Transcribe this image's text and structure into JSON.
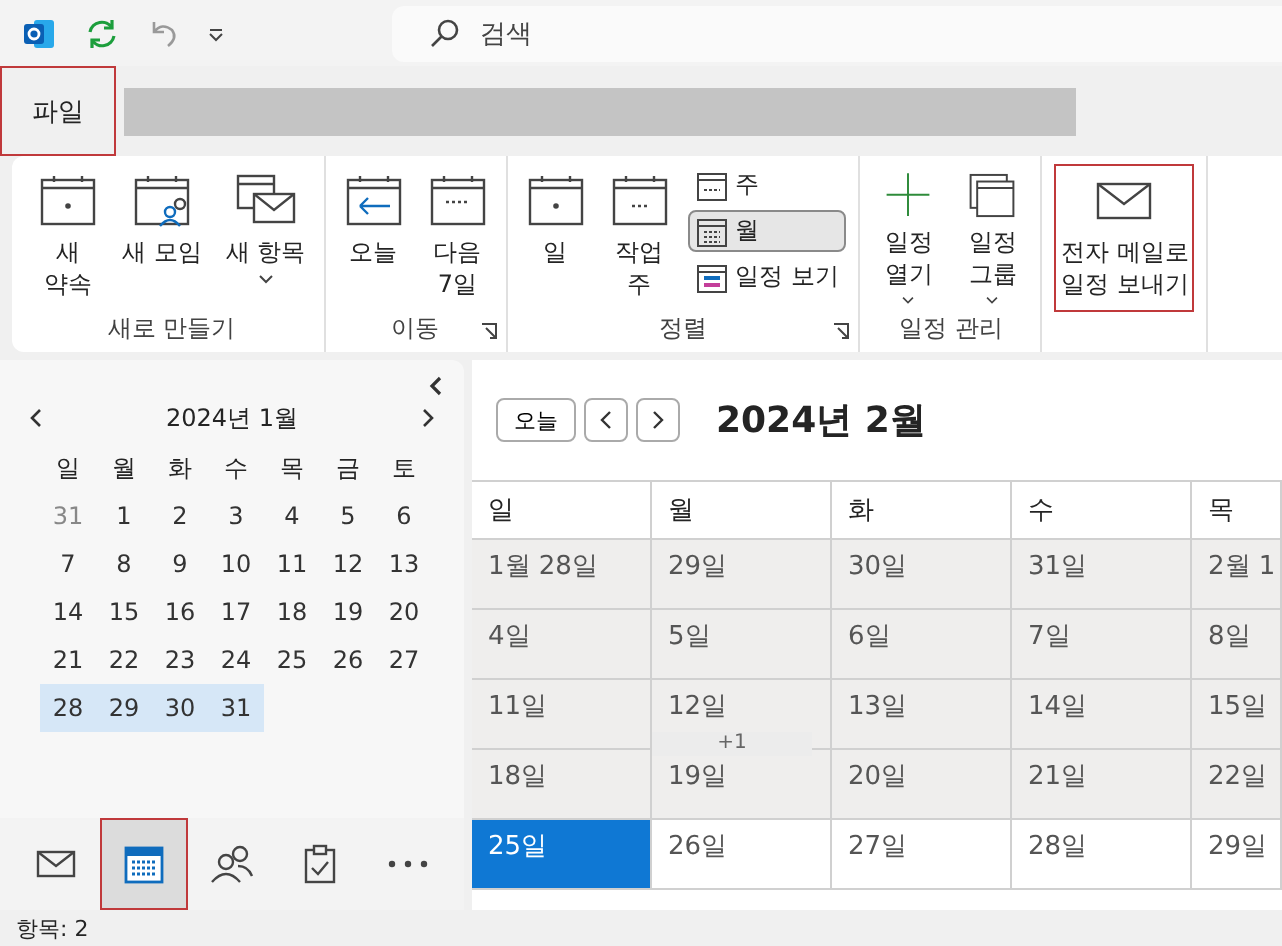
{
  "search": {
    "placeholder": "검색"
  },
  "file_tab": {
    "label": "파일",
    "highlighted": true
  },
  "ribbon": {
    "groups": [
      {
        "label": "새로 만들기",
        "launcher": false,
        "buttons": [
          {
            "kind": "large",
            "label": "새\n약속",
            "dropdown": false,
            "highlighted": false
          },
          {
            "kind": "large",
            "label": "새 모임",
            "dropdown": false,
            "highlighted": false
          },
          {
            "kind": "large",
            "label": "새 항목",
            "dropdown": true,
            "highlighted": false
          }
        ]
      },
      {
        "label": "이동",
        "launcher": true,
        "buttons": [
          {
            "kind": "large",
            "label": "오늘",
            "dropdown": false,
            "highlighted": false
          },
          {
            "kind": "large",
            "label": "다음\n7일",
            "dropdown": false,
            "highlighted": false
          }
        ]
      },
      {
        "label": "정렬",
        "launcher": true,
        "buttons": [
          {
            "kind": "large",
            "label": "일",
            "dropdown": false,
            "highlighted": false
          },
          {
            "kind": "large",
            "label": "작업\n주",
            "dropdown": false,
            "highlighted": false
          },
          {
            "kind": "small",
            "label": "주",
            "selected": false
          },
          {
            "kind": "small",
            "label": "월",
            "selected": true
          },
          {
            "kind": "small",
            "label": "일정 보기",
            "selected": false
          }
        ]
      },
      {
        "label": "일정 관리",
        "launcher": false,
        "buttons": [
          {
            "kind": "large",
            "label": "일정\n열기",
            "dropdown": true,
            "highlighted": false
          },
          {
            "kind": "large",
            "label": "일정\n그룹",
            "dropdown": true,
            "highlighted": false
          }
        ]
      },
      {
        "launcher": false,
        "buttons": [
          {
            "kind": "large",
            "label": "전자 메일로\n일정 보내기",
            "dropdown": false,
            "highlighted": true
          }
        ]
      }
    ]
  },
  "mini_calendar": {
    "title": "2024년 1월",
    "weekdays": [
      "일",
      "월",
      "화",
      "수",
      "목",
      "금",
      "토"
    ],
    "weeks": [
      [
        {
          "day": "31",
          "other_month": true,
          "selected": false
        },
        {
          "day": "1",
          "other_month": false,
          "selected": false
        },
        {
          "day": "2",
          "other_month": false,
          "selected": false
        },
        {
          "day": "3",
          "other_month": false,
          "selected": false
        },
        {
          "day": "4",
          "other_month": false,
          "selected": false
        },
        {
          "day": "5",
          "other_month": false,
          "selected": false
        },
        {
          "day": "6",
          "other_month": false,
          "selected": false
        }
      ],
      [
        {
          "day": "7",
          "other_month": false,
          "selected": false
        },
        {
          "day": "8",
          "other_month": false,
          "selected": false
        },
        {
          "day": "9",
          "other_month": false,
          "selected": false
        },
        {
          "day": "10",
          "other_month": false,
          "selected": false
        },
        {
          "day": "11",
          "other_month": false,
          "selected": false
        },
        {
          "day": "12",
          "other_month": false,
          "selected": false
        },
        {
          "day": "13",
          "other_month": false,
          "selected": false
        }
      ],
      [
        {
          "day": "14",
          "other_month": false,
          "selected": false
        },
        {
          "day": "15",
          "other_month": false,
          "selected": false
        },
        {
          "day": "16",
          "other_month": false,
          "selected": false
        },
        {
          "day": "17",
          "other_month": false,
          "selected": false
        },
        {
          "day": "18",
          "other_month": false,
          "selected": false
        },
        {
          "day": "19",
          "other_month": false,
          "selected": false
        },
        {
          "day": "20",
          "other_month": false,
          "selected": false
        }
      ],
      [
        {
          "day": "21",
          "other_month": false,
          "selected": false
        },
        {
          "day": "22",
          "other_month": false,
          "selected": false
        },
        {
          "day": "23",
          "other_month": false,
          "selected": false
        },
        {
          "day": "24",
          "other_month": false,
          "selected": false
        },
        {
          "day": "25",
          "other_month": false,
          "selected": false
        },
        {
          "day": "26",
          "other_month": false,
          "selected": false
        },
        {
          "day": "27",
          "other_month": false,
          "selected": false
        }
      ],
      [
        {
          "day": "28",
          "other_month": false,
          "selected": true
        },
        {
          "day": "29",
          "other_month": false,
          "selected": true
        },
        {
          "day": "30",
          "other_month": false,
          "selected": true
        },
        {
          "day": "31",
          "other_month": false,
          "selected": true
        }
      ]
    ]
  },
  "calendar": {
    "today_button": "오늘",
    "title": "2024년 2월",
    "columns": [
      "일",
      "월",
      "화",
      "수",
      "목"
    ],
    "weeks": [
      {
        "shaded": true,
        "cells": [
          {
            "label": "1월 28일",
            "selected": false
          },
          {
            "label": "29일",
            "selected": false
          },
          {
            "label": "30일",
            "selected": false
          },
          {
            "label": "31일",
            "selected": false
          },
          {
            "label": "2월 1",
            "selected": false
          }
        ]
      },
      {
        "shaded": true,
        "cells": [
          {
            "label": "4일",
            "selected": false
          },
          {
            "label": "5일",
            "selected": false
          },
          {
            "label": "6일",
            "selected": false
          },
          {
            "label": "7일",
            "selected": false
          },
          {
            "label": "8일",
            "selected": false
          }
        ]
      },
      {
        "shaded": true,
        "cells": [
          {
            "label": "11일",
            "selected": false
          },
          {
            "label": "12일",
            "selected": false,
            "more": "+1"
          },
          {
            "label": "13일",
            "selected": false
          },
          {
            "label": "14일",
            "selected": false
          },
          {
            "label": "15일",
            "selected": false
          }
        ]
      },
      {
        "shaded": true,
        "cells": [
          {
            "label": "18일",
            "selected": false
          },
          {
            "label": "19일",
            "selected": false
          },
          {
            "label": "20일",
            "selected": false
          },
          {
            "label": "21일",
            "selected": false
          },
          {
            "label": "22일",
            "selected": false
          }
        ]
      },
      {
        "shaded": false,
        "cells": [
          {
            "label": "25일",
            "selected": true
          },
          {
            "label": "26일",
            "selected": false
          },
          {
            "label": "27일",
            "selected": false
          },
          {
            "label": "28일",
            "selected": false
          },
          {
            "label": "29일",
            "selected": false
          }
        ]
      }
    ]
  },
  "nav": [
    {
      "selected": false,
      "highlighted": false
    },
    {
      "selected": true,
      "highlighted": true
    },
    {
      "selected": false,
      "highlighted": false
    },
    {
      "selected": false,
      "highlighted": false
    },
    {
      "selected": false,
      "highlighted": false
    }
  ],
  "status_bar": {
    "text": "항목: 2"
  }
}
